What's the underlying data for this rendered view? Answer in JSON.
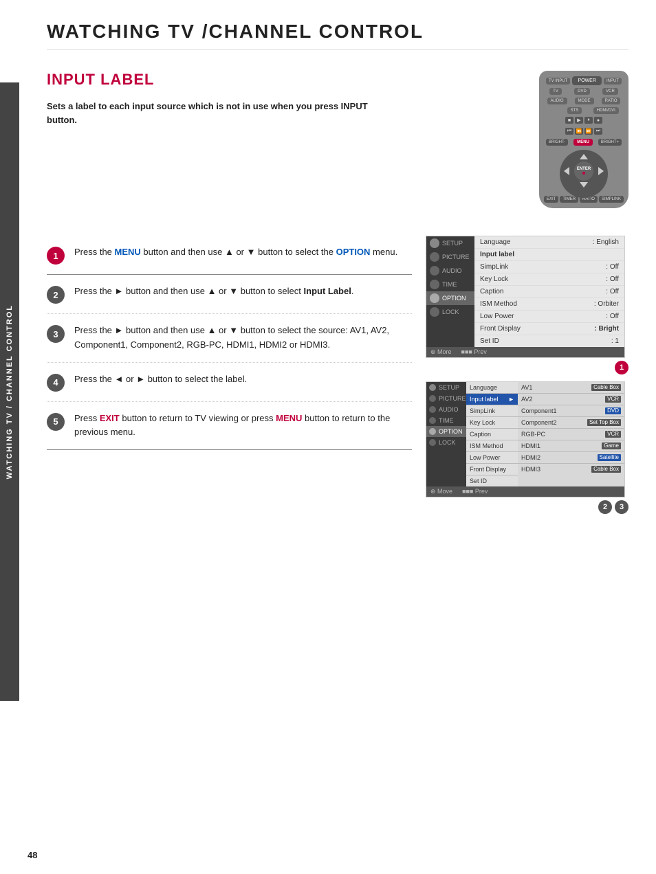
{
  "page": {
    "title": "WATCHING TV /CHANNEL CONTROL",
    "section_title": "INPUT LABEL",
    "page_number": "48"
  },
  "sidebar": {
    "label": "WATCHING TV / CHANNEL CONTROL"
  },
  "description": {
    "text": "Sets a label to each input source which is not in use when you press INPUT button."
  },
  "steps": [
    {
      "number": "1",
      "text_parts": [
        {
          "text": "Press the ",
          "style": "normal"
        },
        {
          "text": "MENU",
          "style": "highlight_blue"
        },
        {
          "text": " button and then use ",
          "style": "normal"
        },
        {
          "text": "▲",
          "style": "normal"
        },
        {
          "text": " or ",
          "style": "normal"
        },
        {
          "text": "▼",
          "style": "normal"
        },
        {
          "text": " button to select the ",
          "style": "normal"
        },
        {
          "text": "OPTION",
          "style": "highlight_blue"
        },
        {
          "text": " menu.",
          "style": "normal"
        }
      ],
      "full_text": "Press the MENU button and then use ▲ or ▼ button to select the OPTION menu."
    },
    {
      "number": "2",
      "text_parts": [
        {
          "text": "Press the ",
          "style": "normal"
        },
        {
          "text": "►",
          "style": "normal"
        },
        {
          "text": " button and then use ",
          "style": "normal"
        },
        {
          "text": "▲",
          "style": "normal"
        },
        {
          "text": " or ",
          "style": "normal"
        },
        {
          "text": "▼",
          "style": "normal"
        },
        {
          "text": " button to select ",
          "style": "normal"
        },
        {
          "text": "Input Label",
          "style": "bold"
        }
      ],
      "full_text": "Press the ► button and then use ▲ or ▼ button to select Input Label."
    },
    {
      "number": "3",
      "text_parts": [
        {
          "text": "Press the ",
          "style": "normal"
        },
        {
          "text": "►",
          "style": "normal"
        },
        {
          "text": " button and then use ",
          "style": "normal"
        },
        {
          "text": "▲",
          "style": "normal"
        },
        {
          "text": " or ",
          "style": "normal"
        },
        {
          "text": "▼",
          "style": "normal"
        },
        {
          "text": " button to select the source: AV1, AV2, Component1, Component2, RGB-PC, HDMI1, HDMI2 or HDMI3.",
          "style": "normal"
        }
      ],
      "full_text": "Press the ► button and then use ▲ or ▼ button to select the source: AV1, AV2, Component1, Component2, RGB-PC, HDMI1, HDMI2 or HDMI3."
    },
    {
      "number": "4",
      "full_text": "Press the ◄ or ► button to select the label."
    },
    {
      "number": "5",
      "full_text": "Press EXIT button to return to TV viewing or press MENU button to return to the previous menu."
    }
  ],
  "menu1": {
    "title": "SETUP",
    "left_items": [
      "SETUP",
      "PICTURE",
      "AUDIO",
      "TIME",
      "OPTION",
      "LOCK"
    ],
    "rows": [
      {
        "label": "Language",
        "value": ": English"
      },
      {
        "label": "Input label",
        "value": ""
      },
      {
        "label": "SimpLink",
        "value": ": Off"
      },
      {
        "label": "Key Lock",
        "value": ": Off"
      },
      {
        "label": "Caption",
        "value": ": Off"
      },
      {
        "label": "ISM Method",
        "value": ": Orbiter"
      },
      {
        "label": "Low Power",
        "value": ": Off"
      },
      {
        "label": "Front Display",
        "value": ": Bright"
      },
      {
        "label": "Set ID",
        "value": ": 1"
      }
    ],
    "footer": "More    Prev"
  },
  "menu2": {
    "title": "SETUP",
    "left_items": [
      "SETUP",
      "PICTURE",
      "AUDIO",
      "TIME",
      "OPTION",
      "LOCK"
    ],
    "rows": [
      {
        "label": "Language",
        "value": "",
        "mid": "",
        "right": ""
      },
      {
        "label": "Input label",
        "value": "►",
        "mid": "AV1",
        "right": "Cable Box"
      },
      {
        "label": "SimpLink",
        "value": "",
        "mid": "AV2",
        "right": "VCR"
      },
      {
        "label": "Key Lock",
        "value": "",
        "mid": "Component1",
        "right": "DVD"
      },
      {
        "label": "Caption",
        "value": "",
        "mid": "Component2",
        "right": "Set Top Box"
      },
      {
        "label": "ISM Method",
        "value": "",
        "mid": "RGB-PC",
        "right": "VCR"
      },
      {
        "label": "Low Power",
        "value": "",
        "mid": "HDMI1",
        "right": "Game"
      },
      {
        "label": "Front Display",
        "value": "",
        "mid": "HDMI2",
        "right": "Satellite"
      },
      {
        "label": "Set ID",
        "value": "",
        "mid": "HDMI3",
        "right": "Cable Box"
      }
    ],
    "footer": "Move    Prev"
  },
  "diagram_refs": {
    "ref1": "1",
    "ref2": "2",
    "ref3": "3"
  }
}
